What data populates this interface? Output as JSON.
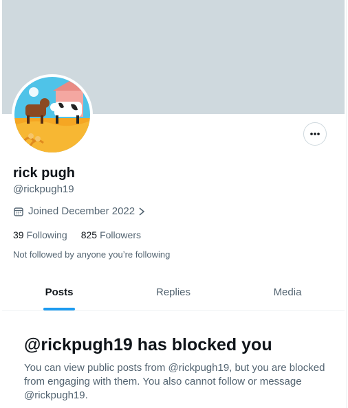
{
  "profile": {
    "display_name": "rick pugh",
    "handle": "@rickpugh19",
    "joined": "Joined December 2022",
    "following_count": "39",
    "following_label": "Following",
    "followers_count": "825",
    "followers_label": "Followers",
    "not_followed_text": "Not followed by anyone you’re following"
  },
  "tabs": [
    {
      "label": "Posts",
      "active": true
    },
    {
      "label": "Replies",
      "active": false
    },
    {
      "label": "Media",
      "active": false
    }
  ],
  "blocked": {
    "title": "@rickpugh19 has blocked you",
    "body": "You can view public posts from @rickpugh19, but you are blocked from engaging with them. You also cannot follow or message @rickpugh19."
  },
  "icons": {
    "more": "more-options-icon",
    "calendar": "calendar-icon",
    "chevron": "chevron-right-icon"
  },
  "colors": {
    "banner": "#cfd9de",
    "accent": "#1d9bf0",
    "text_primary": "#0f1419",
    "text_secondary": "#536471"
  }
}
